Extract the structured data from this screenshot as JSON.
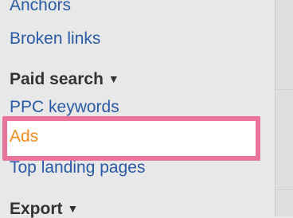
{
  "sidebar": {
    "anchors_label": "Anchors",
    "broken_links_label": "Broken links",
    "paid_search": {
      "heading": "Paid search",
      "caret": "▼",
      "items": [
        {
          "label": "PPC keywords"
        },
        {
          "label": "Ads"
        },
        {
          "label": "Top landing pages"
        }
      ]
    },
    "export": {
      "heading": "Export",
      "caret": "▼"
    }
  },
  "colors": {
    "link": "#2a59a8",
    "selected_text": "#f28a1e",
    "highlight_border": "#e9739a",
    "background": "#e8e8e8"
  }
}
